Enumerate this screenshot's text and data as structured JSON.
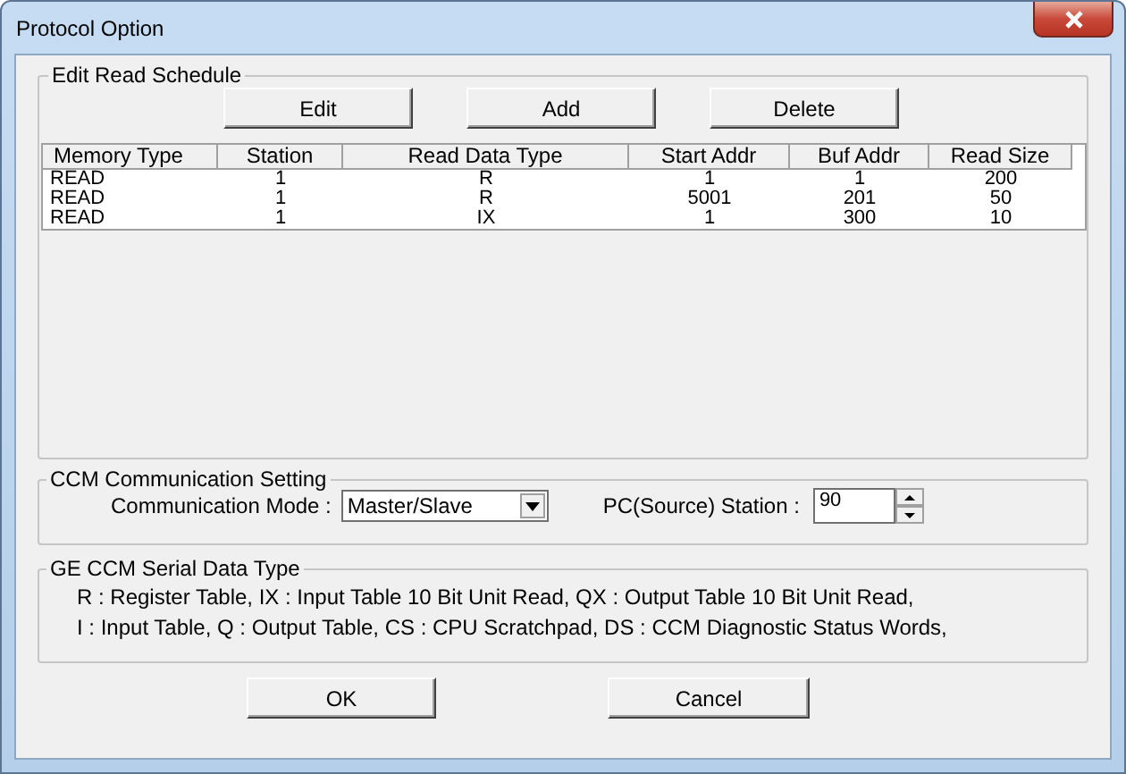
{
  "window": {
    "title": "Protocol Option"
  },
  "schedule": {
    "title": "Edit Read Schedule",
    "buttons": [
      "Edit",
      "Add",
      "Delete"
    ],
    "columns": [
      "Memory Type",
      "Station",
      "Read Data Type",
      "Start Addr",
      "Buf Addr",
      "Read Size"
    ],
    "rows": [
      [
        "READ",
        "1",
        "R",
        "1",
        "1",
        "200"
      ],
      [
        "READ",
        "1",
        "R",
        "5001",
        "201",
        "50"
      ],
      [
        "READ",
        "1",
        "IX",
        "1",
        "300",
        "10"
      ]
    ]
  },
  "ccm": {
    "title": "CCM Communication Setting",
    "mode_label": "Communication Mode :",
    "mode_value": "Master/Slave",
    "station_label": "PC(Source) Station :",
    "station_value": "90"
  },
  "data_types": {
    "title": "GE CCM Serial Data Type",
    "lines": [
      "R : Register Table,  IX : Input Table 10 Bit Unit Read,  QX : Output Table 10 Bit Unit Read,",
      "I : Input Table,  Q : Output Table,  CS : CPU Scratchpad,  DS : CCM Diagnostic Status Words,"
    ]
  },
  "buttons": [
    "OK",
    "Cancel"
  ]
}
